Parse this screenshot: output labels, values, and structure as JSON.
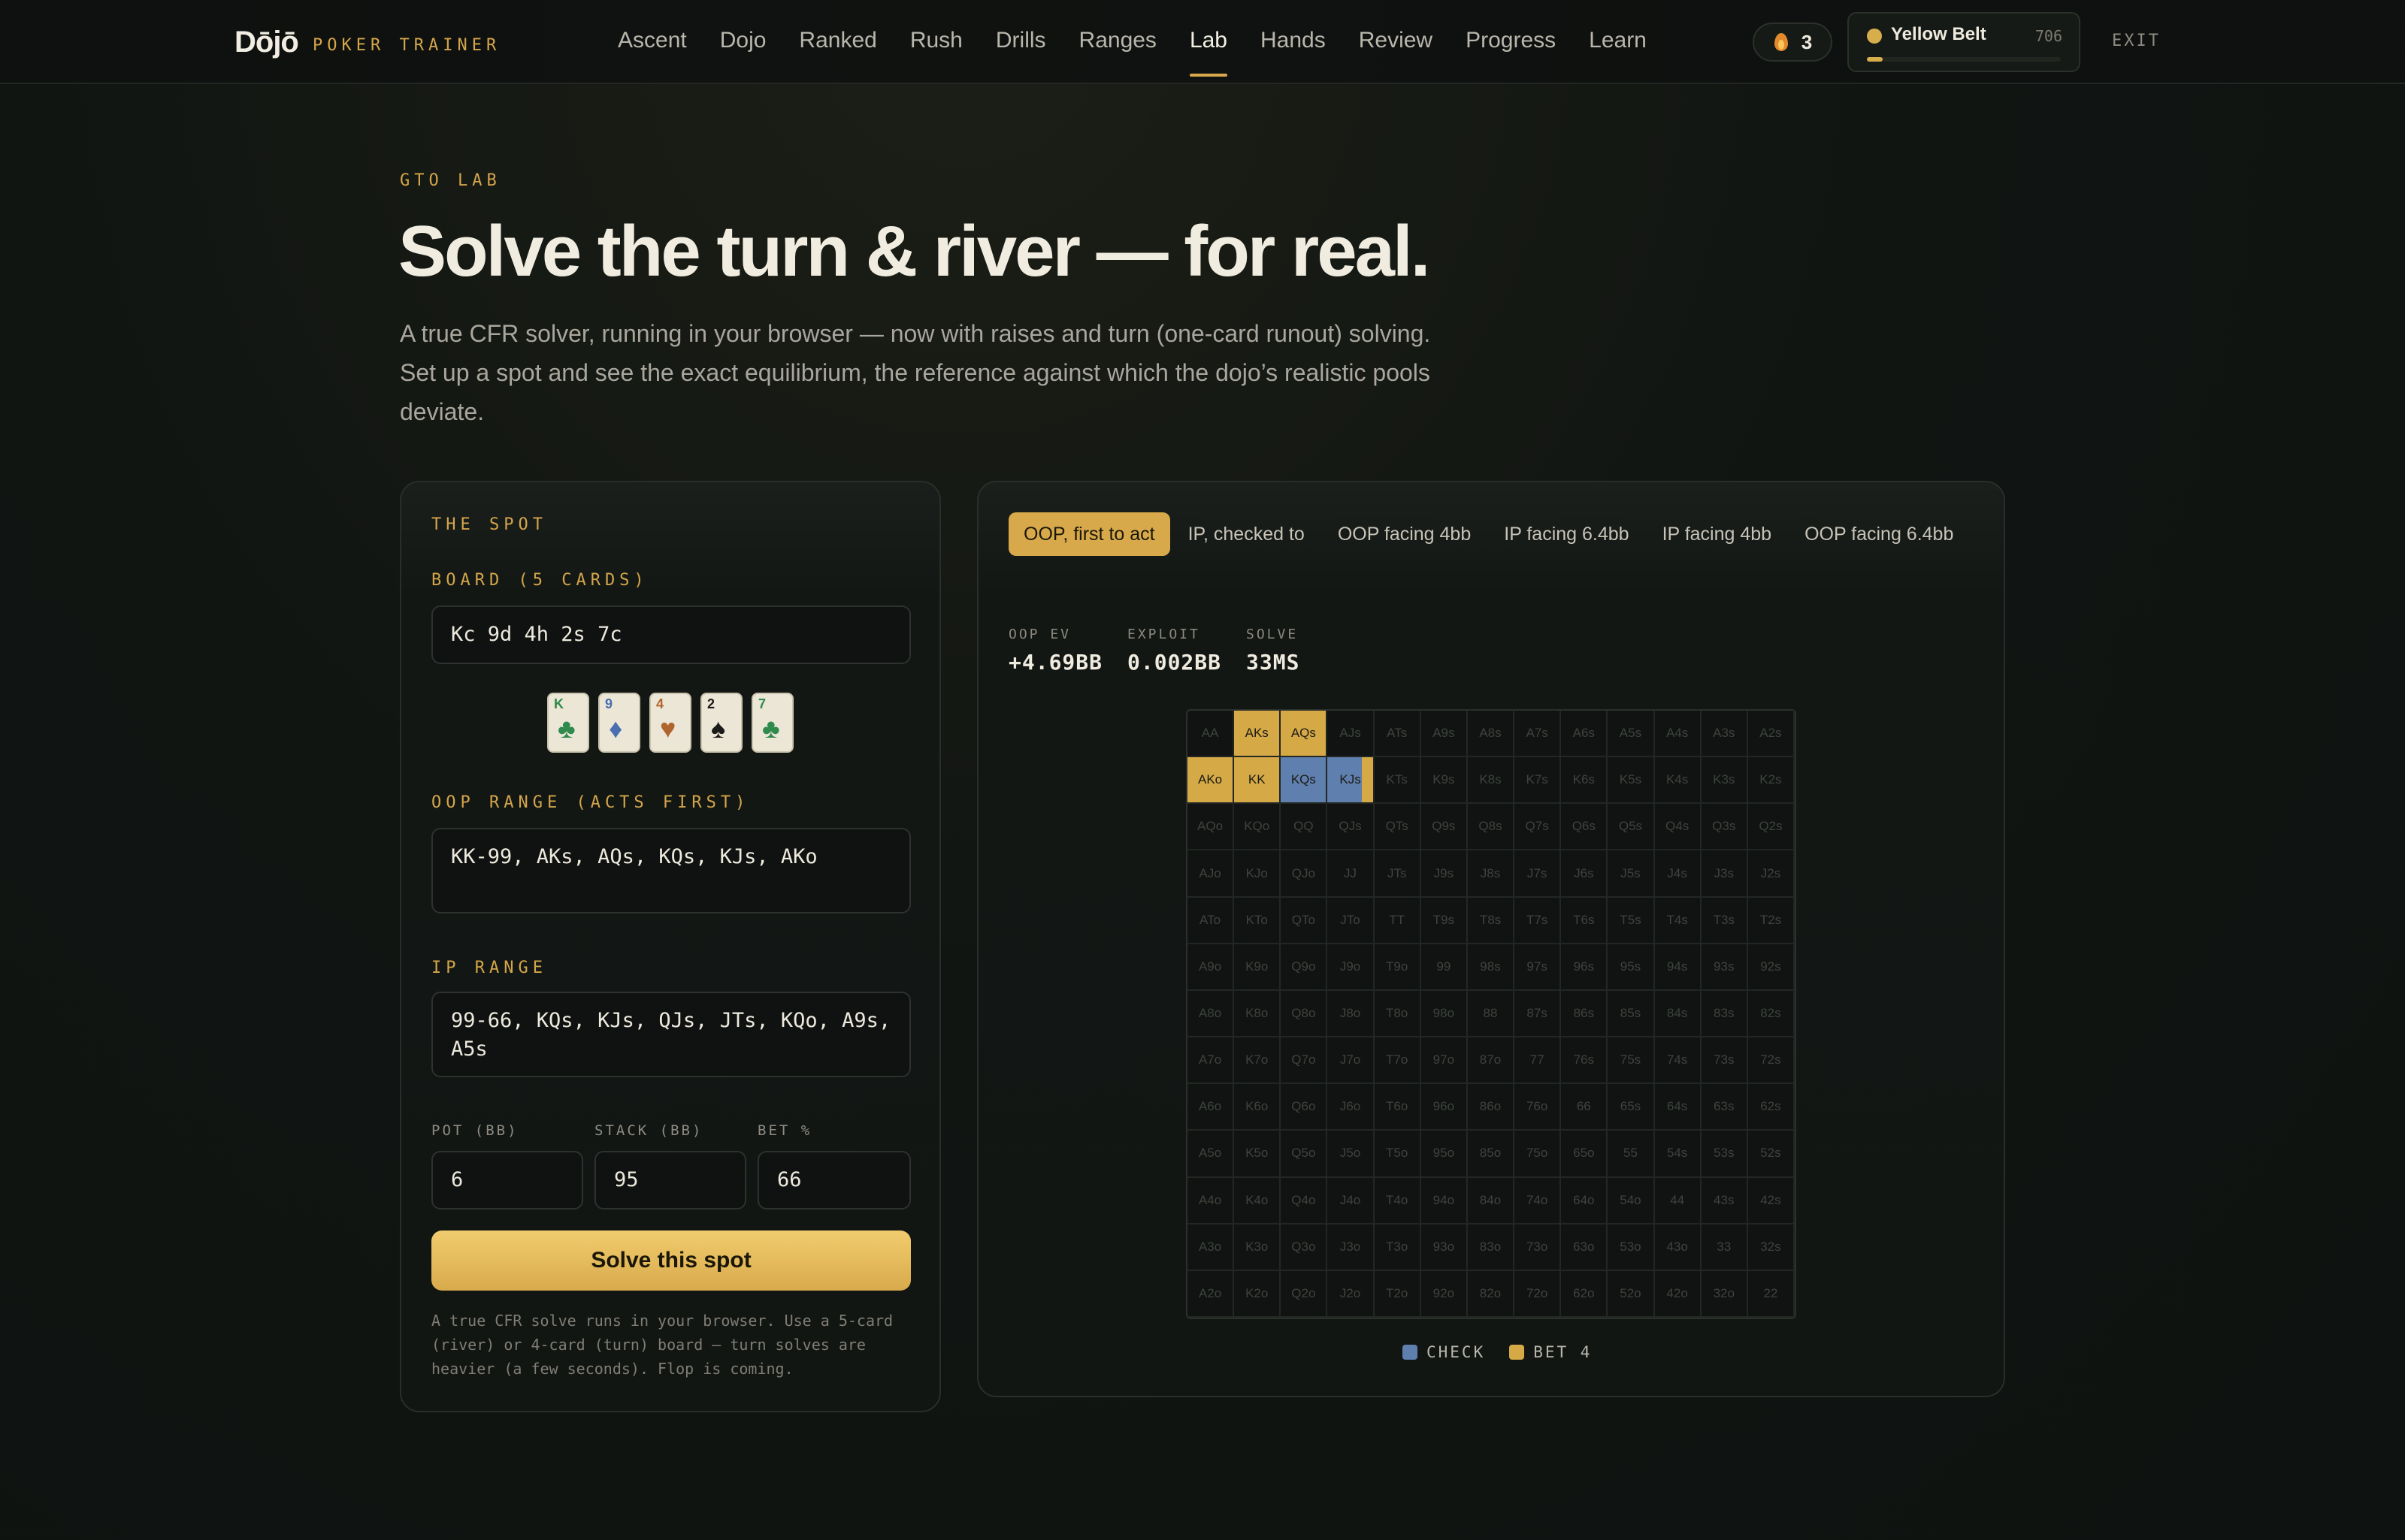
{
  "nav": {
    "logo": "Dōjō",
    "logo_sub": "POKER TRAINER",
    "items": [
      "Ascent",
      "Dojo",
      "Ranked",
      "Rush",
      "Drills",
      "Ranges",
      "Lab",
      "Hands",
      "Review",
      "Progress",
      "Learn"
    ],
    "active": "Lab",
    "streak": "3",
    "belt_name": "Yellow Belt",
    "belt_xp": "706",
    "belt_progress": 0.08,
    "exit": "EXIT"
  },
  "hero": {
    "eyebrow": "GTO LAB",
    "title": "Solve the turn & river — for real.",
    "lede": "A true CFR solver, running in your browser — now with raises and turn (one-card runout) solving. Set up a spot and see the exact equilibrium, the reference against which the dojo’s realistic pools deviate."
  },
  "spot": {
    "heading": "THE SPOT",
    "board_label": "BOARD (5 CARDS)",
    "board_value": "Kc 9d 4h 2s 7c",
    "board_cards": [
      {
        "rank": "K",
        "suit": "♣",
        "color": "#2f8a4c"
      },
      {
        "rank": "9",
        "suit": "♦",
        "color": "#4a6fb0"
      },
      {
        "rank": "4",
        "suit": "♥",
        "color": "#b0652e"
      },
      {
        "rank": "2",
        "suit": "♠",
        "color": "#1b1b1b"
      },
      {
        "rank": "7",
        "suit": "♣",
        "color": "#2f8a4c"
      }
    ],
    "oop_label": "OOP RANGE (ACTS FIRST)",
    "oop_value": "KK-99, AKs, AQs, KQs, KJs, AKo",
    "ip_label": "IP RANGE",
    "ip_value": "99-66, KQs, KJs, QJs, JTs, KQo, A9s, A5s",
    "pot_label": "POT (BB)",
    "pot_value": "6",
    "stack_label": "STACK (BB)",
    "stack_value": "95",
    "bet_label": "BET %",
    "bet_value": "66",
    "solve_label": "Solve this spot",
    "footnote": "A true CFR solve runs in your browser. Use a 5-card (river) or 4-card (turn) board — turn solves are heavier (a few seconds). Flop is coming."
  },
  "result": {
    "tabs": [
      "OOP, first to act",
      "IP, checked to",
      "OOP facing 4bb",
      "IP facing 6.4bb",
      "IP facing 4bb",
      "OOP facing 6.4bb"
    ],
    "active_tab": "OOP, first to act",
    "stats": [
      {
        "label": "OOP EV",
        "value": "+4.69bb"
      },
      {
        "label": "EXPLOIT",
        "value": "0.002bb"
      },
      {
        "label": "SOLVE",
        "value": "33ms"
      }
    ],
    "legend": [
      {
        "label": "CHECK",
        "color": "#5f7fae"
      },
      {
        "label": "BET 4",
        "color": "#d6a947"
      }
    ],
    "ranks": [
      "A",
      "K",
      "Q",
      "J",
      "T",
      "9",
      "8",
      "7",
      "6",
      "5",
      "4",
      "3",
      "2"
    ],
    "strategy": {
      "AKs": {
        "check": 0.0,
        "bet": 1.0
      },
      "AQs": {
        "check": 0.0,
        "bet": 1.0
      },
      "AKo": {
        "check": 0.0,
        "bet": 1.0
      },
      "KK": {
        "check": 0.0,
        "bet": 1.0
      },
      "KQs": {
        "check": 1.0,
        "bet": 0.0
      },
      "KJs": {
        "check": 0.75,
        "bet": 0.25
      }
    }
  }
}
